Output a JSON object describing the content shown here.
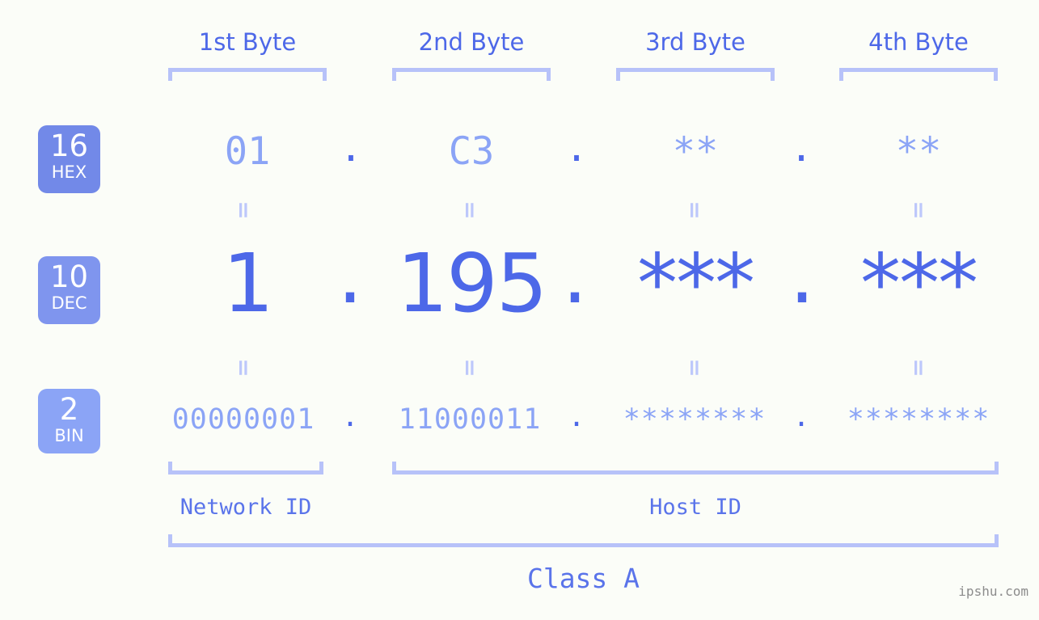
{
  "header": {
    "byte_labels": [
      "1st Byte",
      "2nd Byte",
      "3rd Byte",
      "4th Byte"
    ]
  },
  "bases": [
    {
      "number": "16",
      "name": "HEX",
      "color": "#7289e8"
    },
    {
      "number": "10",
      "name": "DEC",
      "color": "#7f95ee"
    },
    {
      "number": "2",
      "name": "BIN",
      "color": "#8ba4f6"
    }
  ],
  "rows": {
    "hex": {
      "bytes": [
        "01",
        "C3",
        "**",
        "**"
      ],
      "separator": "."
    },
    "dec": {
      "bytes": [
        "1",
        "195",
        "***",
        "***"
      ],
      "separator": "."
    },
    "bin": {
      "bytes": [
        "00000001",
        "11000011",
        "********",
        "********"
      ],
      "separator": "."
    }
  },
  "equality": {
    "symbol": "="
  },
  "footer": {
    "network_id_label": "Network ID",
    "host_id_label": "Host ID",
    "class_label": "Class A",
    "watermark": "ipshu.com"
  },
  "colors": {
    "background": "#fbfdf8",
    "accent_strong": "#4d68e8",
    "accent_light": "#8ba4f6",
    "bracket": "#b7c2f9",
    "label_blue": "#5a74ea"
  }
}
